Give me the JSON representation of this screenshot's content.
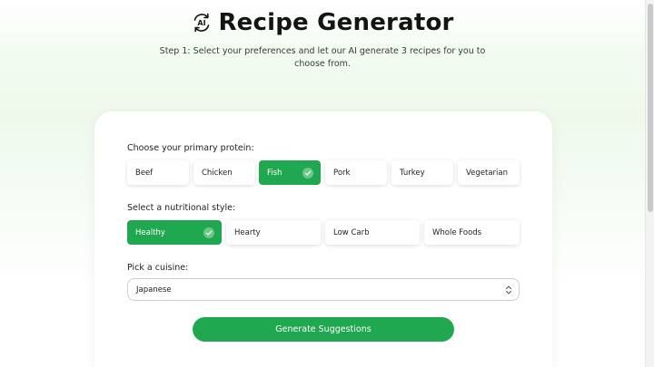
{
  "header": {
    "title": "Recipe Generator",
    "subtitle": "Step 1: Select your preferences and let our AI generate 3 recipes for you to choose from.",
    "icon": "ai-cycle-icon"
  },
  "protein": {
    "label": "Choose your primary protein:",
    "options": [
      "Beef",
      "Chicken",
      "Fish",
      "Pork",
      "Turkey",
      "Vegetarian"
    ],
    "selected": "Fish"
  },
  "style": {
    "label": "Select a nutritional style:",
    "options": [
      "Healthy",
      "Hearty",
      "Low Carb",
      "Whole Foods"
    ],
    "selected": "Healthy"
  },
  "cuisine": {
    "label": "Pick a cuisine:",
    "value": "Japanese"
  },
  "generate_label": "Generate Suggestions",
  "colors": {
    "accent": "#1fa84f",
    "text": "#141414"
  }
}
